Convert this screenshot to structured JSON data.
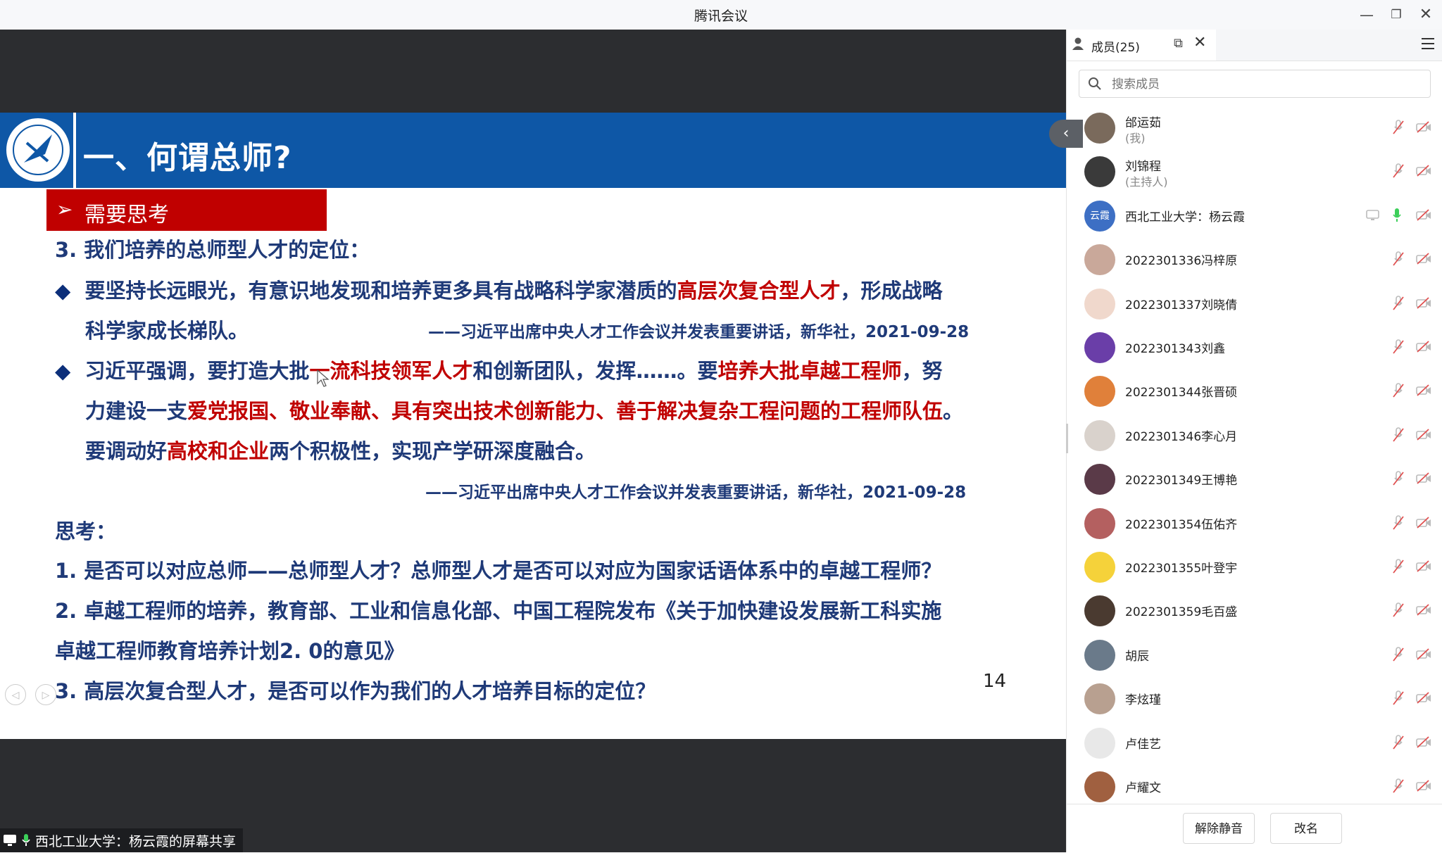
{
  "window": {
    "title": "腾讯会议"
  },
  "slide": {
    "title": "一、何谓总师?",
    "section_label": "需要思考",
    "heading": "3. 我们培养的总师型人才的定位：",
    "b1_a": "要坚持长远眼光，有意识地发现和培养更多具有战略科学家潜质的",
    "b1_hl": "高层次复合型人才",
    "b1_b": "，形成战略",
    "b1_c": "科学家成长梯队。",
    "src1": "——习近平出席中央人才工作会议并发表重要讲话，新华社，2021-09-28",
    "b2_a": "习近平强调，要打造大批",
    "b2_hl1": "一流科技领军人才",
    "b2_b": "和创新团队，发挥……。要",
    "b2_hl2": "培养大批卓越工程师",
    "b2_c": "，努",
    "b2_d": "力建设一支",
    "b2_hl3": "爱党报国、敬业奉献、具有突出技术创新能力、善于解决复杂工程问题的工程师队伍",
    "b2_e": "。",
    "b2_f": "要调动好",
    "b2_hl4": "高校和企业",
    "b2_g": "两个积极性，实现产学研深度融合。",
    "src2": "——习近平出席中央人才工作会议并发表重要讲话，新华社，2021-09-28",
    "think": "思考：",
    "q1": "1. 是否可以对应总师——总师型人才？总师型人才是否可以对应为国家话语体系中的卓越工程师？",
    "q2a": "2. 卓越工程师的培养，教育部、工业和信息化部、中国工程院发布《关于加快建设发展新工科实施",
    "q2b": "卓越工程师教育培养计划2. 0的意见》",
    "q3": "3. 高层次复合型人才，是否可以作为我们的人才培养目标的定位？",
    "page_number": "14"
  },
  "share_status": "西北工业大学：杨云霞的屏幕共享",
  "panel": {
    "tab_label": "成员(25)",
    "search_placeholder": "搜索成员",
    "members": [
      {
        "name": "邰运茹",
        "sub": "(我)",
        "avatar_color": "#7a6a5c"
      },
      {
        "name": "刘锦程",
        "sub": "(主持人)",
        "avatar_color": "#3a3a3a"
      },
      {
        "name": "西北工业大学：杨云霞",
        "sub": "",
        "avatar_color": "#3d6fc4",
        "avatar_text": "云霞",
        "mic_on": true
      },
      {
        "name": "2022301336冯梓原",
        "sub": "",
        "avatar_color": "#c9a89a"
      },
      {
        "name": "2022301337刘晓倩",
        "sub": "",
        "avatar_color": "#f0d8cc"
      },
      {
        "name": "2022301343刘鑫",
        "sub": "",
        "avatar_color": "#6a3ea8"
      },
      {
        "name": "2022301344张晋硕",
        "sub": "",
        "avatar_color": "#e0803a"
      },
      {
        "name": "2022301346李心月",
        "sub": "",
        "avatar_color": "#d9d2cc"
      },
      {
        "name": "2022301349王博艳",
        "sub": "",
        "avatar_color": "#5a3a48"
      },
      {
        "name": "2022301354伍佑齐",
        "sub": "",
        "avatar_color": "#b46060"
      },
      {
        "name": "2022301355叶登宇",
        "sub": "",
        "avatar_color": "#f5d23a"
      },
      {
        "name": "2022301359毛百盛",
        "sub": "",
        "avatar_color": "#4a3a30"
      },
      {
        "name": "胡辰",
        "sub": "",
        "avatar_color": "#6a7a8a"
      },
      {
        "name": "李炫瑾",
        "sub": "",
        "avatar_color": "#b8a090"
      },
      {
        "name": "卢佳艺",
        "sub": "",
        "avatar_color": "#e8e8e8"
      },
      {
        "name": "卢耀文",
        "sub": "",
        "avatar_color": "#a06040"
      }
    ],
    "unmute_all": "解除静音",
    "rename": "改名"
  }
}
